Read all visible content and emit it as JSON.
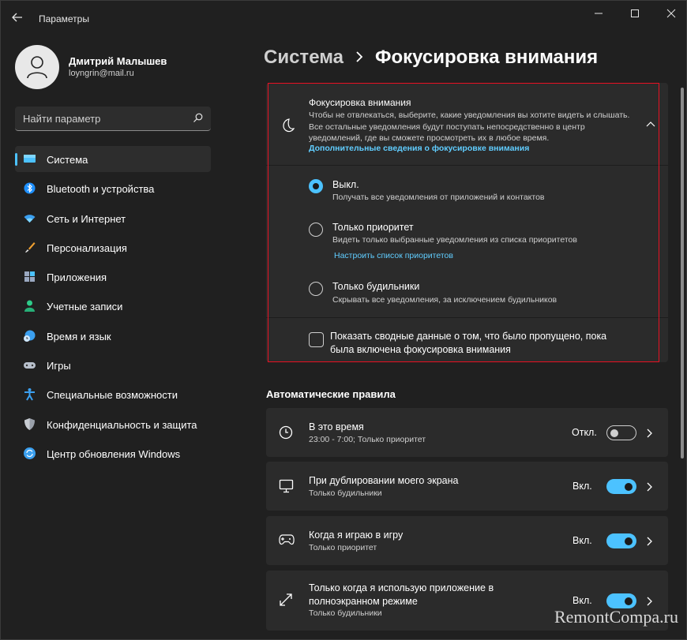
{
  "window": {
    "title": "Параметры"
  },
  "user": {
    "name": "Дмитрий Малышев",
    "email": "loyngrin@mail.ru"
  },
  "search": {
    "placeholder": "Найти параметр"
  },
  "sidebar": {
    "items": [
      {
        "label": "Система",
        "icon": "monitor-icon",
        "active": true
      },
      {
        "label": "Bluetooth и устройства",
        "icon": "bluetooth-icon"
      },
      {
        "label": "Сеть и Интернет",
        "icon": "wifi-icon"
      },
      {
        "label": "Персонализация",
        "icon": "brush-icon"
      },
      {
        "label": "Приложения",
        "icon": "apps-icon"
      },
      {
        "label": "Учетные записи",
        "icon": "person-icon"
      },
      {
        "label": "Время и язык",
        "icon": "globe-clock-icon"
      },
      {
        "label": "Игры",
        "icon": "gamepad-icon"
      },
      {
        "label": "Специальные возможности",
        "icon": "accessibility-icon"
      },
      {
        "label": "Конфиденциальность и защита",
        "icon": "shield-icon"
      },
      {
        "label": "Центр обновления Windows",
        "icon": "update-icon"
      }
    ]
  },
  "breadcrumb": {
    "parent": "Система",
    "current": "Фокусировка внимания"
  },
  "focus": {
    "title": "Фокусировка внимания",
    "description": "Чтобы не отвлекаться, выберите, какие уведомления вы хотите видеть и слышать. Все остальные уведомления будут поступать непосредственно в центр уведомлений, где вы сможете просмотреть их в любое время.",
    "link": "Дополнительные сведения о фокусировке внимания",
    "options": [
      {
        "label": "Выкл.",
        "desc": "Получать все уведомления от приложений и контактов",
        "selected": true
      },
      {
        "label": "Только приоритет",
        "desc": "Видеть только выбранные уведомления из списка приоритетов",
        "link": "Настроить список приоритетов",
        "selected": false
      },
      {
        "label": "Только будильники",
        "desc": "Скрывать все уведомления, за исключением будильников",
        "selected": false
      }
    ],
    "summary_checkbox": {
      "label": "Показать сводные данные о том, что было пропущено, пока была включена фокусировка внимания",
      "checked": false
    }
  },
  "rules": {
    "title": "Автоматические правила",
    "items": [
      {
        "label": "В это время",
        "sub": "23:00 - 7:00; Только приоритет",
        "state": "Откл.",
        "on": false
      },
      {
        "label": "При дублировании моего экрана",
        "sub": "Только будильники",
        "state": "Вкл.",
        "on": true
      },
      {
        "label": "Когда я играю в игру",
        "sub": "Только приоритет",
        "state": "Вкл.",
        "on": true
      },
      {
        "label": "Только когда я использую приложение в полноэкранном режиме",
        "sub": "Только будильники",
        "state": "Вкл.",
        "on": true
      }
    ]
  },
  "watermark": "RemontCompa.ru",
  "colors": {
    "accent": "#4cc2ff",
    "link": "#60cdff",
    "highlight_border": "#e81123",
    "background": "#202020",
    "card": "#2b2b2b"
  }
}
